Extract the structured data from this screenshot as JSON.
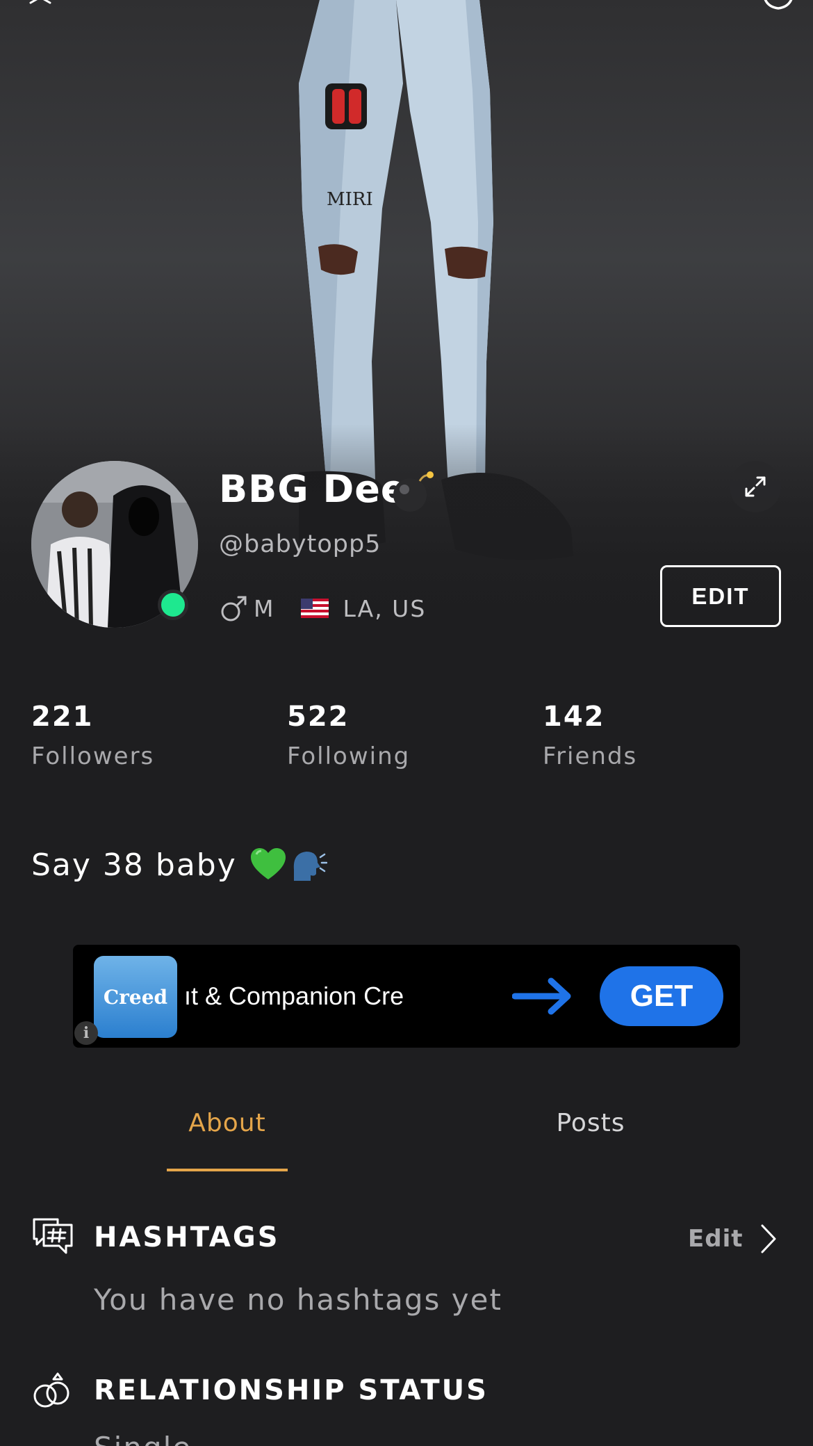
{
  "profile": {
    "display_name": "BBG Dee",
    "handle": "@babytopp5",
    "gender": "M",
    "location": "LA, US",
    "online": true,
    "edit_label": "EDIT"
  },
  "stats": [
    {
      "value": "221",
      "label": "Followers"
    },
    {
      "value": "522",
      "label": "Following"
    },
    {
      "value": "142",
      "label": "Friends"
    }
  ],
  "bio": "Say 38 baby",
  "ad": {
    "logo_text": "Creed",
    "text": "ıt & Companion     Cre",
    "cta": "GET",
    "info": "i"
  },
  "tabs": [
    {
      "label": "About",
      "active": true
    },
    {
      "label": "Posts",
      "active": false
    }
  ],
  "sections": {
    "hashtags": {
      "title": "HASHTAGS",
      "edit_label": "Edit",
      "empty_text": "You have no hashtags yet"
    },
    "relationship": {
      "title": "RELATIONSHIP STATUS",
      "value": "Single"
    }
  },
  "colors": {
    "accent": "#e4a54a",
    "online": "#1ee88f",
    "ad_button": "#1f73e8",
    "background": "#1e1e20"
  },
  "icons": [
    "close-icon",
    "gear-icon",
    "expand-icon",
    "male-icon",
    "us-flag-icon",
    "bomb-emoji",
    "green-heart-emoji",
    "speaking-head-emoji",
    "hashtag-chat-icon",
    "rings-icon",
    "chevron-right-icon",
    "arrow-right-icon",
    "info-icon"
  ]
}
